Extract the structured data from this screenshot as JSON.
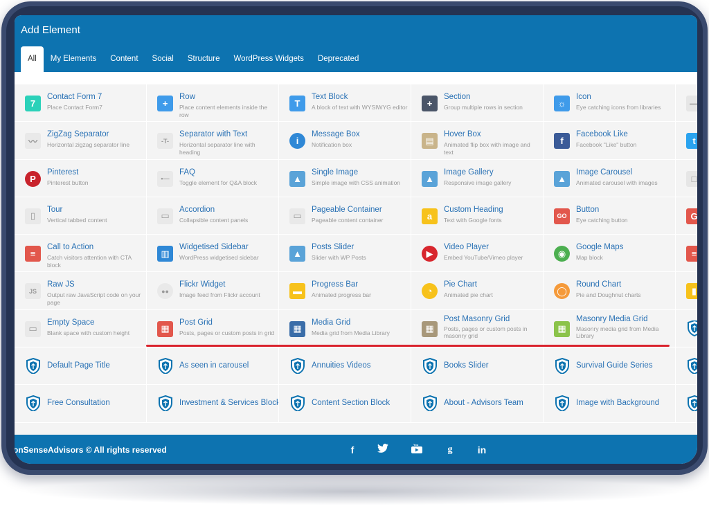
{
  "panel": {
    "title": "Add Element"
  },
  "tabs": [
    {
      "label": "All"
    },
    {
      "label": "My Elements"
    },
    {
      "label": "Content"
    },
    {
      "label": "Social"
    },
    {
      "label": "Structure"
    },
    {
      "label": "WordPress Widgets"
    },
    {
      "label": "Deprecated"
    }
  ],
  "elements": [
    {
      "name": "Contact Form 7",
      "desc": "Place Contact Form7",
      "icon": "contact-form-7-icon",
      "color": "#2bd1b9",
      "glyph": "7"
    },
    {
      "name": "Row",
      "desc": "Place content elements inside the row",
      "icon": "plus-icon",
      "color": "#3f9bea",
      "glyph": "+"
    },
    {
      "name": "Text Block",
      "desc": "A block of text with WYSIWYG editor",
      "icon": "text-block-icon",
      "color": "#3f9bea",
      "glyph": "T"
    },
    {
      "name": "Section",
      "desc": "Group multiple rows in section",
      "icon": "section-plus-icon",
      "color": "#4a5568",
      "glyph": "+"
    },
    {
      "name": "Icon",
      "desc": "Eye catching icons from libraries",
      "icon": "sun-icon",
      "color": "#3f9bea",
      "glyph": "☼"
    },
    {
      "name": "",
      "desc": "",
      "icon": "separator-icon",
      "color": "#e6e6e6",
      "glyph": "—"
    },
    {
      "name": "ZigZag Separator",
      "desc": "Horizontal zigzag separator line",
      "icon": "zigzag-icon",
      "color": "#e9e9e9",
      "glyph": "〰"
    },
    {
      "name": "Separator with Text",
      "desc": "Horizontal separator line with heading",
      "icon": "separator-text-icon",
      "color": "#e9e9e9",
      "glyph": "-T-"
    },
    {
      "name": "Message Box",
      "desc": "Notification box",
      "icon": "info-icon",
      "color": "#2f88d6",
      "glyph": "i",
      "round": true
    },
    {
      "name": "Hover Box",
      "desc": "Animated flip box with image and text",
      "icon": "hover-box-icon",
      "color": "#c9b48a",
      "glyph": "▤"
    },
    {
      "name": "Facebook Like",
      "desc": "Facebook \"Like\" button",
      "icon": "facebook-icon",
      "color": "#3b5b98",
      "glyph": "f"
    },
    {
      "name": "",
      "desc": "",
      "icon": "twitter-icon",
      "color": "#2aa3ef",
      "glyph": "t"
    },
    {
      "name": "Pinterest",
      "desc": "Pinterest button",
      "icon": "pinterest-icon",
      "color": "#c8232c",
      "glyph": "P",
      "round": true
    },
    {
      "name": "FAQ",
      "desc": "Toggle element for Q&A block",
      "icon": "faq-icon",
      "color": "#e9e9e9",
      "glyph": "•—"
    },
    {
      "name": "Single Image",
      "desc": "Simple image with CSS animation",
      "icon": "image-icon",
      "color": "#5aa3d8",
      "glyph": "▲"
    },
    {
      "name": "Image Gallery",
      "desc": "Responsive image gallery",
      "icon": "image-gallery-icon",
      "color": "#5aa3d8",
      "glyph": "▲"
    },
    {
      "name": "Image Carousel",
      "desc": "Animated carousel with images",
      "icon": "image-carousel-icon",
      "color": "#5aa3d8",
      "glyph": "▲"
    },
    {
      "name": "",
      "desc": "",
      "icon": "box-icon",
      "color": "#e6e6e6",
      "glyph": "□"
    },
    {
      "name": "Tour",
      "desc": "Vertical tabbed content",
      "icon": "tour-icon",
      "color": "#e9e9e9",
      "glyph": "▯"
    },
    {
      "name": "Accordion",
      "desc": "Collapsible content panels",
      "icon": "accordion-icon",
      "color": "#e9e9e9",
      "glyph": "▭"
    },
    {
      "name": "Pageable Container",
      "desc": "Pageable content container",
      "icon": "pageable-container-icon",
      "color": "#e9e9e9",
      "glyph": "▭"
    },
    {
      "name": "Custom Heading",
      "desc": "Text with Google fonts",
      "icon": "custom-heading-icon",
      "color": "#f7c21b",
      "glyph": "a"
    },
    {
      "name": "Button",
      "desc": "Eye catching button",
      "icon": "go-button-icon",
      "color": "#e2574c",
      "glyph": "GO"
    },
    {
      "name": "",
      "desc": "",
      "icon": "go-button-icon",
      "color": "#e2574c",
      "glyph": "G"
    },
    {
      "name": "Call to Action",
      "desc": "Catch visitors attention with CTA block",
      "icon": "call-to-action-icon",
      "color": "#e2574c",
      "glyph": "≡"
    },
    {
      "name": "Widgetised Sidebar",
      "desc": "WordPress widgetised sidebar",
      "icon": "sidebar-icon",
      "color": "#2f88d6",
      "glyph": "▥"
    },
    {
      "name": "Posts Slider",
      "desc": "Slider with WP Posts",
      "icon": "posts-slider-icon",
      "color": "#5aa3d8",
      "glyph": "▲"
    },
    {
      "name": "Video Player",
      "desc": "Embed YouTube/Vimeo player",
      "icon": "play-icon",
      "color": "#d8262d",
      "glyph": "▶",
      "round": true
    },
    {
      "name": "Google Maps",
      "desc": "Map block",
      "icon": "map-pin-icon",
      "color": "#4caf50",
      "glyph": "◉",
      "round": true
    },
    {
      "name": "",
      "desc": "",
      "icon": "cta-icon",
      "color": "#e2574c",
      "glyph": "≡"
    },
    {
      "name": "Raw JS",
      "desc": "Output raw JavaScript code on your page",
      "icon": "raw-js-icon",
      "color": "#e9e9e9",
      "glyph": "JS"
    },
    {
      "name": "Flickr Widget",
      "desc": "Image feed from Flickr account",
      "icon": "flickr-icon",
      "color": "#e9e9e9",
      "glyph": "●●",
      "round": true
    },
    {
      "name": "Progress Bar",
      "desc": "Animated progress bar",
      "icon": "progress-bar-icon",
      "color": "#f7c21b",
      "glyph": "▬"
    },
    {
      "name": "Pie Chart",
      "desc": "Animated pie chart",
      "icon": "pie-chart-icon",
      "color": "#f7c21b",
      "glyph": "◔",
      "round": true
    },
    {
      "name": "Round Chart",
      "desc": "Pie and Doughnut charts",
      "icon": "round-chart-icon",
      "color": "#f59a3a",
      "glyph": "◯",
      "round": true
    },
    {
      "name": "",
      "desc": "",
      "icon": "bar-chart-icon",
      "color": "#f7c21b",
      "glyph": "▮"
    },
    {
      "name": "Empty Space",
      "desc": "Blank space with custom height",
      "icon": "empty-space-icon",
      "color": "#e9e9e9",
      "glyph": "▭"
    },
    {
      "name": "Post Grid",
      "desc": "Posts, pages or custom posts in grid",
      "icon": "post-grid-icon",
      "color": "#e2574c",
      "glyph": "▦"
    },
    {
      "name": "Media Grid",
      "desc": "Media grid from Media Library",
      "icon": "media-grid-icon",
      "color": "#3a6da8",
      "glyph": "▦"
    },
    {
      "name": "Post Masonry Grid",
      "desc": "Posts, pages or custom posts in masonry grid",
      "icon": "post-masonry-grid-icon",
      "color": "#a8987a",
      "glyph": "▦",
      "two": true
    },
    {
      "name": "Masonry Media Grid",
      "desc": "Masonry media grid from Media Library",
      "icon": "masonry-media-grid-icon",
      "color": "#8bc34a",
      "glyph": "▦",
      "two": true
    },
    {
      "name": "",
      "desc": "",
      "icon": "shield-logo-icon",
      "color": "#0d73b0",
      "glyph": "",
      "shield": true
    },
    {
      "name": "Default Page Title",
      "desc": "",
      "icon": "shield-logo-icon",
      "shield": true
    },
    {
      "name": "As seen in carousel",
      "desc": "",
      "icon": "shield-logo-icon",
      "shield": true
    },
    {
      "name": "Annuities Videos",
      "desc": "",
      "icon": "shield-logo-icon",
      "shield": true
    },
    {
      "name": "Books Slider",
      "desc": "",
      "icon": "shield-logo-icon",
      "shield": true
    },
    {
      "name": "Survival Guide Series",
      "desc": "",
      "icon": "shield-logo-icon",
      "shield": true
    },
    {
      "name": "",
      "desc": "",
      "icon": "shield-logo-icon",
      "shield": true
    },
    {
      "name": "Free Consultation",
      "desc": "",
      "icon": "shield-logo-icon",
      "shield": true
    },
    {
      "name": "Investment & Services Block",
      "desc": "",
      "icon": "shield-logo-icon",
      "shield": true
    },
    {
      "name": "Content Section Block",
      "desc": "",
      "icon": "shield-logo-icon",
      "shield": true
    },
    {
      "name": "About - Advisors Team",
      "desc": "",
      "icon": "shield-logo-icon",
      "shield": true
    },
    {
      "name": "Image with Background",
      "desc": "",
      "icon": "shield-logo-icon",
      "shield": true
    },
    {
      "name": "",
      "desc": "",
      "icon": "shield-logo-icon",
      "shield": true
    }
  ],
  "footer": {
    "copyright": "onSenseAdvisors © All rights reserved",
    "social": [
      {
        "icon": "facebook-icon",
        "glyph": "f"
      },
      {
        "icon": "twitter-icon",
        "glyph": "🐦"
      },
      {
        "icon": "youtube-icon",
        "glyph": "▶"
      },
      {
        "icon": "google-icon",
        "glyph": "g"
      },
      {
        "icon": "linkedin-icon",
        "glyph": "in"
      }
    ]
  }
}
